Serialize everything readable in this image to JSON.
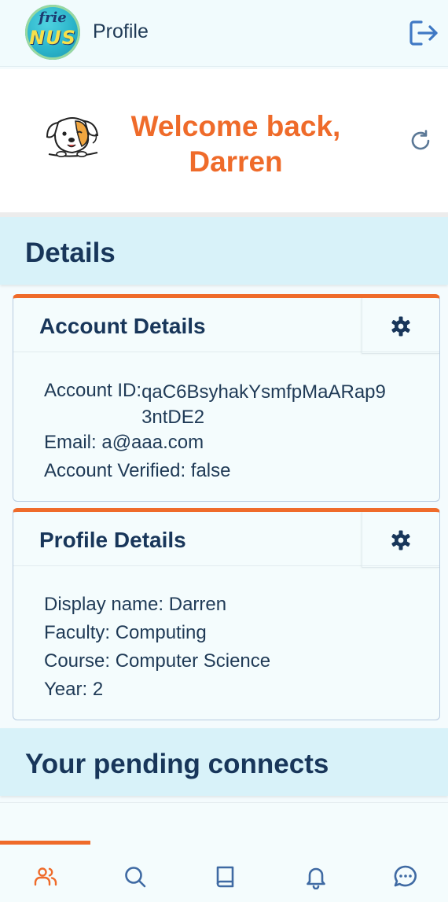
{
  "header": {
    "logo": {
      "top_text": "frie",
      "bottom_text": "NUS"
    },
    "title": "Profile",
    "logout_icon": "logout-icon"
  },
  "welcome": {
    "line1": "Welcome back,",
    "line2": "Darren",
    "avatar_icon": "dog-avatar",
    "refresh_icon": "refresh-icon"
  },
  "sections": {
    "details_title": "Details",
    "pending_title": "Your pending connects"
  },
  "account_card": {
    "title": "Account Details",
    "settings_icon": "gear-icon",
    "account_id_label": "Account ID: ",
    "account_id": "qaC6BsyhakYsmfpMaARap93ntDE2",
    "email": "Email: a@aaa.com",
    "verified": "Account Verified: false"
  },
  "profile_card": {
    "title": "Profile Details",
    "settings_icon": "gear-icon",
    "display_name": "Display name: Darren",
    "faculty": "Faculty: Computing",
    "course": "Course: Computer Science",
    "year": "Year: 2"
  },
  "bottom_nav": {
    "active_index": 0,
    "items": [
      "people-icon",
      "search-icon",
      "book-icon",
      "bell-icon",
      "chat-icon"
    ]
  },
  "colors": {
    "accent": "#ef6b2a",
    "heading": "#18365a",
    "section_bg": "#d8f2f9",
    "nav_icon": "#3f6aa3"
  }
}
